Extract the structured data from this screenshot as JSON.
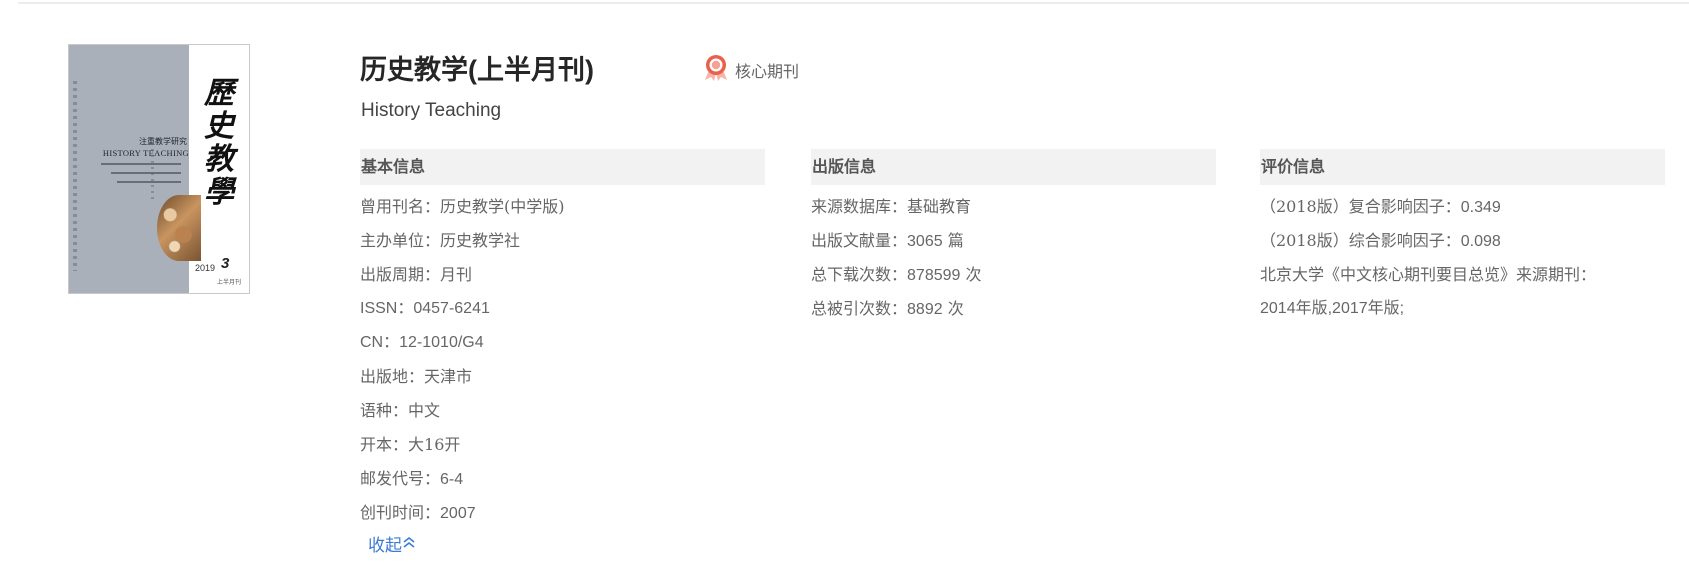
{
  "journal": {
    "title_cn": "历史教学(上半月刊)",
    "title_en": "History Teaching",
    "core_label": "核心期刊"
  },
  "cover": {
    "title_chars": [
      "歷",
      "史",
      "教",
      "學"
    ],
    "subtitle": "注重教学研究",
    "english": "HISTORY TEACHING",
    "year": "2019",
    "issue": "3",
    "edition": "上半月刊"
  },
  "basic_info": {
    "heading": "基本信息",
    "rows": [
      {
        "label": "曾用刊名：",
        "value": "历史教学(中学版)"
      },
      {
        "label": "主办单位：",
        "value": "历史教学社"
      },
      {
        "label": "出版周期：",
        "value": "月刊"
      },
      {
        "label": "ISSN：",
        "value": "0457-6241"
      },
      {
        "label": "CN：",
        "value": "12-1010/G4"
      },
      {
        "label": "出版地：",
        "value": "天津市"
      },
      {
        "label": "语种：",
        "value": "中文"
      },
      {
        "label": "开本：",
        "value": "大16开"
      },
      {
        "label": "邮发代号：",
        "value": "6-4"
      },
      {
        "label": "创刊时间：",
        "value": "2007"
      }
    ]
  },
  "publication_info": {
    "heading": "出版信息",
    "rows": [
      {
        "label": "来源数据库：",
        "value": "基础教育"
      },
      {
        "label": "出版文献量：",
        "value": "3065",
        "unit": " 篇"
      },
      {
        "label": "总下载次数：",
        "value": "878599",
        "unit": " 次"
      },
      {
        "label": "总被引次数：",
        "value": "8892",
        "unit": " 次"
      }
    ]
  },
  "evaluation_info": {
    "heading": "评价信息",
    "rows": [
      {
        "label": "（2018版）复合影响因子：",
        "value": "0.349"
      },
      {
        "label": "（2018版）综合影响因子：",
        "value": "0.098"
      }
    ],
    "source_label": "北京大学《中文核心期刊要目总览》来源期刊：",
    "source_value": "2014年版,2017年版;"
  },
  "collapse_label": "收起",
  "colors": {
    "link": "#3b7bd4",
    "badge": "#e9604b",
    "header_bg": "#f2f2f2",
    "text": "#666666",
    "title": "#262626"
  },
  "icons": {
    "core_badge": "award-ribbon-icon",
    "collapse": "double-chevron-up-icon"
  }
}
